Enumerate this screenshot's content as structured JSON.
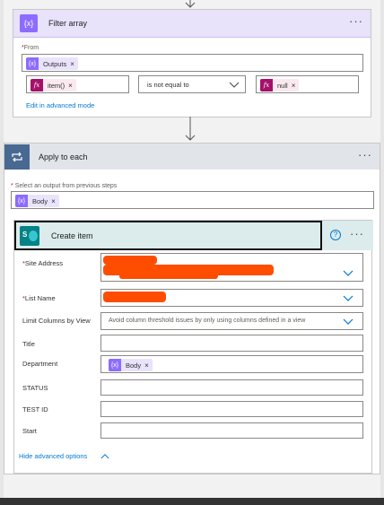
{
  "filter": {
    "title": "Filter array",
    "from_label": "From",
    "from_token": "Outputs",
    "left_operand": "item()",
    "operator": "is not equal to",
    "right_operand": "null",
    "advanced_link": "Edit in advanced mode",
    "more": "···"
  },
  "apply": {
    "title": "Apply to each",
    "select_label": "Select an output from previous steps",
    "select_token": "Body",
    "more": "···"
  },
  "create": {
    "title": "Create item",
    "help": "?",
    "more": "···",
    "site_label": "Site Address",
    "list_label": "List Name",
    "limit_label": "Limit Columns by View",
    "limit_placeholder": "Avoid column threshold issues by only using columns defined in a view",
    "title_label": "Title",
    "department_label": "Department",
    "department_token": "Body",
    "status_label": "STATUS",
    "testid_label": "TEST ID",
    "start_label": "Start",
    "hide_link": "Hide advanced options"
  },
  "token_close": "×",
  "required_mark": "*",
  "icons": {
    "filter": "curly-braces-icon",
    "apply": "loop-icon",
    "create": "sharepoint-icon",
    "fx": "fx-icon",
    "token": "variable-icon"
  },
  "colors": {
    "filter_header": "#e8e2fb",
    "filter_accent": "#8c6cff",
    "apply_header": "#e1e5ea",
    "apply_accent": "#486991",
    "create_header": "#dcebeb",
    "sharepoint": "#038387",
    "fx": "#a4106a",
    "link": "#0078d4",
    "redaction": "#ff4d00"
  }
}
